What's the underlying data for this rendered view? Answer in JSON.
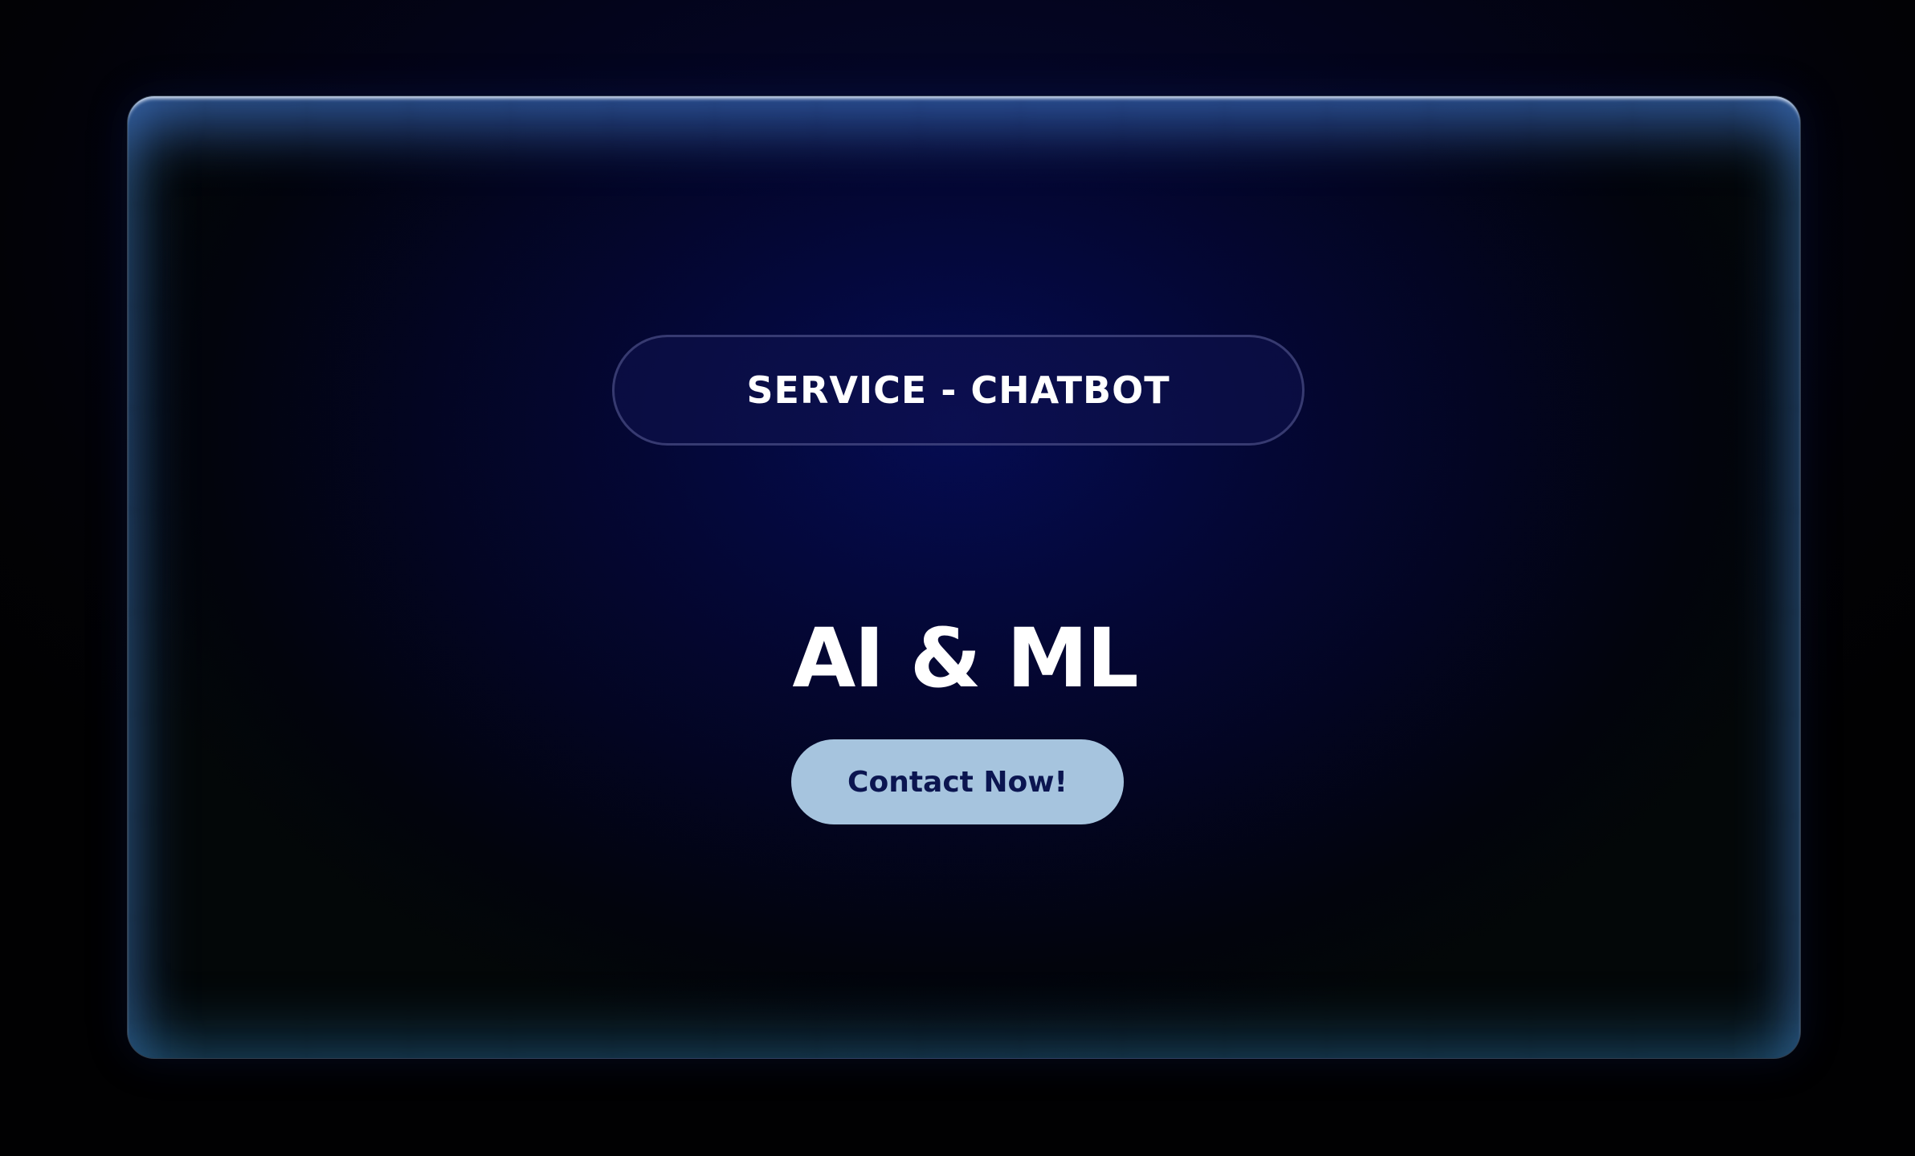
{
  "hero": {
    "service_label": "SERVICE - CHATBOT",
    "title": "AI & ML",
    "cta_label": "Contact Now!"
  },
  "colors": {
    "page_background": "#020206",
    "card_glow": "#050c52",
    "button_fill": "#a6c4de",
    "button_text": "#0b1550",
    "text": "#ffffff"
  }
}
